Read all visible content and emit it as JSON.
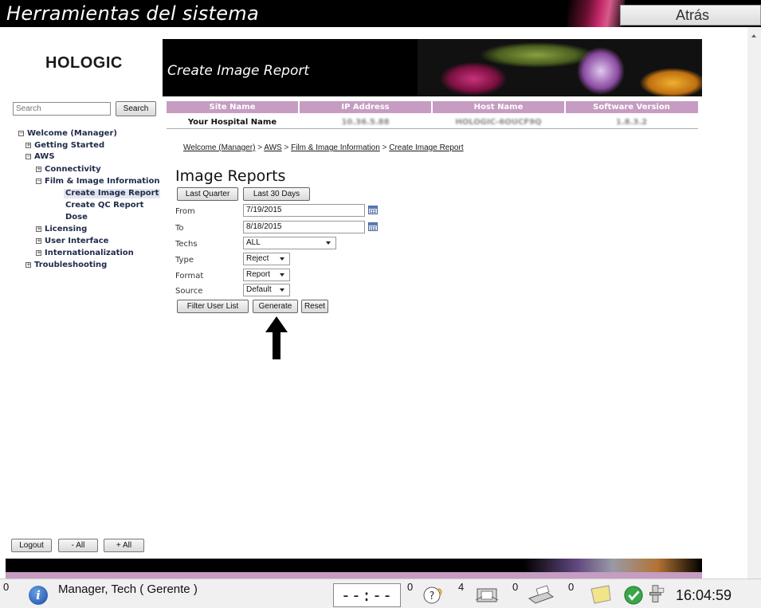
{
  "app": {
    "title": "Herramientas del sistema",
    "back_label": "Atrás"
  },
  "sidebar": {
    "logo": "HOLOGIC",
    "search": {
      "placeholder": "Search",
      "button_label": "Search"
    },
    "tree": {
      "welcome": "Welcome (Manager)",
      "getting_started": "Getting Started",
      "aws": "AWS",
      "connectivity": "Connectivity",
      "film_image_info": "Film & Image Information",
      "create_image_report": "Create Image Report",
      "create_qc_report": "Create QC Report",
      "dose": "Dose",
      "licensing": "Licensing",
      "user_interface": "User Interface",
      "internationalization": "Internationalization",
      "troubleshooting": "Troubleshooting"
    },
    "bottom_buttons": {
      "logout": "Logout",
      "collapse_all": "- All",
      "expand_all": "+ All"
    }
  },
  "banner": {
    "title": "Create Image Report"
  },
  "info_table": {
    "headers": [
      "Site Name",
      "IP Address",
      "Host Name",
      "Software Version"
    ],
    "row": [
      "Your Hospital Name",
      "10.36.5.88",
      "HOLOGIC-6OUCF9Q",
      "1.8.3.2"
    ]
  },
  "breadcrumb": {
    "items": [
      "Welcome (Manager)",
      "AWS",
      "Film & Image Information",
      "Create Image Report"
    ],
    "separator": ">"
  },
  "form": {
    "title": "Image Reports",
    "last_quarter_label": "Last Quarter",
    "last_30_days_label": "Last 30 Days",
    "from_label": "From",
    "from_value": "7/19/2015",
    "to_label": "To",
    "to_value": "8/18/2015",
    "techs_label": "Techs",
    "techs_value": "ALL",
    "type_label": "Type",
    "type_value": "Reject",
    "format_label": "Format",
    "format_value": "Report",
    "source_label": "Source",
    "source_value": "Default",
    "filter_user_list_label": "Filter User List",
    "generate_label": "Generate",
    "reset_label": "Reset"
  },
  "taskbar": {
    "info_count": "0",
    "user": "Manager, Tech ( Gerente )",
    "timer": "--:--",
    "help_count": "0",
    "studies_count": "4",
    "printer_count": "0",
    "notes_count": "0",
    "clock": "16:04:59"
  },
  "colors": {
    "accent_header": "#c69cc2",
    "banner_bg": "#000000",
    "selected_node": "#e3e6ee"
  }
}
